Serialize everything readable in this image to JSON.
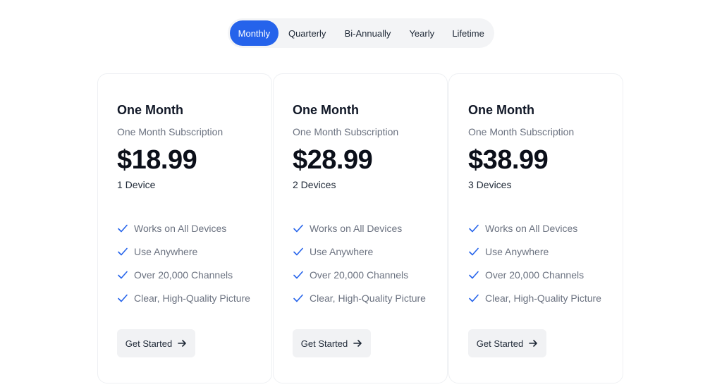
{
  "billing_tabs": [
    {
      "label": "Monthly",
      "active": true
    },
    {
      "label": "Quarterly",
      "active": false
    },
    {
      "label": "Bi-Annually",
      "active": false
    },
    {
      "label": "Yearly",
      "active": false
    },
    {
      "label": "Lifetime",
      "active": false
    }
  ],
  "colors": {
    "accent": "#2563eb",
    "check": "#2563eb"
  },
  "plans": [
    {
      "title": "One Month",
      "subtitle": "One Month Subscription",
      "price": "$18.99",
      "devices": "1 Device",
      "features": [
        "Works on All Devices",
        "Use Anywhere",
        "Over 20,000 Channels",
        "Clear, High-Quality Picture"
      ],
      "cta": "Get Started"
    },
    {
      "title": "One Month",
      "subtitle": "One Month Subscription",
      "price": "$28.99",
      "devices": "2 Devices",
      "features": [
        "Works on All Devices",
        "Use Anywhere",
        "Over 20,000 Channels",
        "Clear, High-Quality Picture"
      ],
      "cta": "Get Started"
    },
    {
      "title": "One Month",
      "subtitle": "One Month Subscription",
      "price": "$38.99",
      "devices": "3 Devices",
      "features": [
        "Works on All Devices",
        "Use Anywhere",
        "Over 20,000 Channels",
        "Clear, High-Quality Picture"
      ],
      "cta": "Get Started"
    }
  ]
}
